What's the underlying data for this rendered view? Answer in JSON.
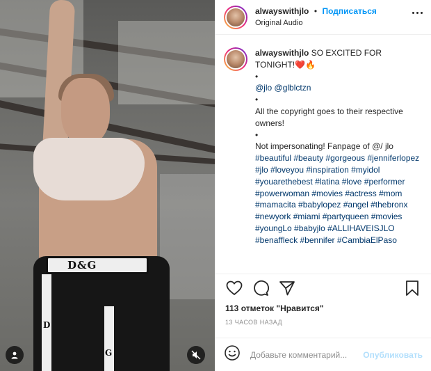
{
  "post": {
    "username": "alwayswithjlo",
    "separator": "•",
    "follow_label": "Подписаться",
    "audio_label": "Original Audio",
    "media": {
      "waistband_text": "D&G",
      "stripe_letters": [
        "D",
        "G"
      ]
    },
    "caption": {
      "username": "alwayswithjlo",
      "first_line": "SO EXCITED FOR TONIGHT!",
      "emoji": {
        "heart": "❤️",
        "fire": "🔥"
      },
      "lines": [
        "•",
        "@jlo @glblctzn",
        "•",
        "All the copyright goes to their respective owners!",
        "•",
        "Not impersonating! Fanpage of @/ jlo",
        "#beautiful #beauty #gorgeous #jenniferlopez #jlo #loveyou #inspiration #myidol #youarethebest #latina #love #performer #powerwoman #movies #actress #mom #mamacita #babylopez #angel #thebronx #newyork #miami #partyqueen #movies #youngLo #babyjlo #ALLIHAVEISJLO #benaffleck #bennifer #CambiaElPaso"
      ]
    },
    "likes_text": "113 отметок \"Нравится\"",
    "timestamp": "13 ЧАСОВ НАЗАД",
    "comment": {
      "placeholder": "Добавьте комментарий...",
      "post_label": "Опубликовать"
    },
    "icons": {
      "like": "heart-outline-icon",
      "comment": "comment-bubble-icon",
      "share": "paper-plane-icon",
      "save": "bookmark-icon",
      "emoji": "smiley-icon",
      "more": "more-dots-icon",
      "user": "user-tag-icon",
      "mute": "speaker-muted-icon"
    },
    "colors": {
      "accent": "#0095f6",
      "text": "#262626",
      "muted": "#8e8e8e",
      "link": "#00376b",
      "post_disabled": "#b2dffc"
    }
  }
}
